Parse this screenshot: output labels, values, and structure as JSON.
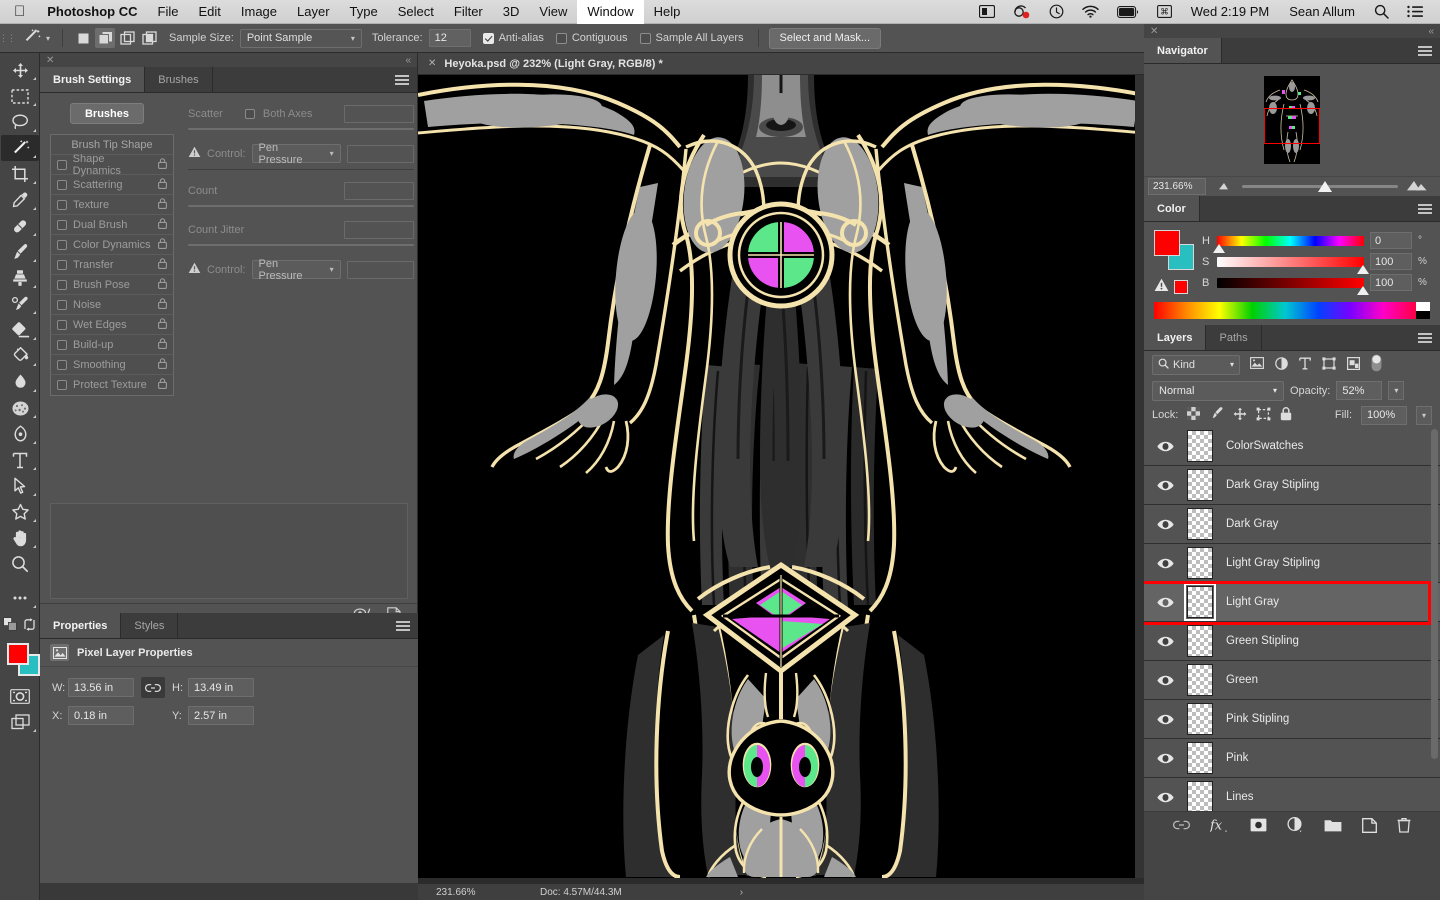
{
  "menubar": {
    "apple_icon": "apple-logo-icon",
    "app_name": "Photoshop CC",
    "items": [
      "File",
      "Edit",
      "Image",
      "Layer",
      "Type",
      "Select",
      "Filter",
      "3D",
      "View",
      "Window",
      "Help"
    ],
    "active_item": "Window",
    "status_icons": [
      "screen-mirroring-icon",
      "record-icon",
      "time-machine-icon",
      "wifi-icon",
      "battery-icon",
      "input-source-icon"
    ],
    "clock": "Wed 2:19 PM",
    "user": "Sean Allum",
    "search_icon": "search-icon",
    "control_center_icon": "control-center-icon"
  },
  "options_bar": {
    "tool_icon": "magic-wand-icon",
    "tool_caret": "chevron-down-icon",
    "selection_modes": [
      "new-selection-icon",
      "add-to-selection-icon",
      "subtract-from-selection-icon",
      "intersect-selection-icon"
    ],
    "active_selection_mode_index": 1,
    "sample_size_label": "Sample Size:",
    "sample_size_value": "Point Sample",
    "tolerance_label": "Tolerance:",
    "tolerance_value": "12",
    "anti_alias_label": "Anti-alias",
    "anti_alias_checked": true,
    "contiguous_label": "Contiguous",
    "contiguous_checked": false,
    "sample_all_layers_label": "Sample All Layers",
    "sample_all_layers_checked": false,
    "select_and_mask_label": "Select and Mask...",
    "right_icons": [
      "search-icon",
      "workspace-icon",
      "chevron-down-icon",
      "share-icon"
    ]
  },
  "toolbar": {
    "tools": [
      {
        "name": "move-tool",
        "icon": "move-icon"
      },
      {
        "name": "rectangular-marquee-tool",
        "icon": "marquee-icon"
      },
      {
        "name": "lasso-tool",
        "icon": "lasso-icon"
      },
      {
        "name": "magic-wand-tool",
        "icon": "magic-wand-icon",
        "selected": true
      },
      {
        "name": "crop-tool",
        "icon": "crop-icon"
      },
      {
        "name": "eyedropper-tool",
        "icon": "eyedropper-icon"
      },
      {
        "name": "spot-healing-brush-tool",
        "icon": "healing-brush-icon"
      },
      {
        "name": "brush-tool",
        "icon": "brush-icon"
      },
      {
        "name": "clone-stamp-tool",
        "icon": "stamp-icon"
      },
      {
        "name": "history-brush-tool",
        "icon": "history-brush-icon"
      },
      {
        "name": "eraser-tool",
        "icon": "eraser-icon"
      },
      {
        "name": "gradient-tool",
        "icon": "paint-bucket-icon"
      },
      {
        "name": "blur-tool",
        "icon": "blur-drop-icon"
      },
      {
        "name": "dodge-tool",
        "icon": "sponge-icon"
      },
      {
        "name": "pen-tool",
        "icon": "pen-icon"
      },
      {
        "name": "type-tool",
        "icon": "type-t-icon"
      },
      {
        "name": "path-selection-tool",
        "icon": "arrow-pointer-icon"
      },
      {
        "name": "custom-shape-tool",
        "icon": "shape-star-icon"
      },
      {
        "name": "hand-tool",
        "icon": "hand-icon"
      },
      {
        "name": "zoom-tool",
        "icon": "magnifier-icon"
      },
      {
        "name": "edit-toolbar",
        "icon": "ellipsis-icon"
      }
    ],
    "quick_icons": [
      "default-colors-icon",
      "swap-colors-icon"
    ],
    "foreground_color": "#fe0000",
    "background_color": "#29bfc0",
    "quick_mask_icon": "quick-mask-icon",
    "screen_mode_icon": "screen-mode-icon"
  },
  "brush_settings": {
    "tabs": [
      {
        "label": "Brush Settings",
        "active": true
      },
      {
        "label": "Brushes",
        "active": false
      }
    ],
    "menu_icon": "panel-menu-icon",
    "close_icon": "close-icon",
    "collapse_icon": "collapse-icon",
    "brushes_button": "Brushes",
    "list_header": "Brush Tip Shape",
    "options": [
      "Shape Dynamics",
      "Scattering",
      "Texture",
      "Dual Brush",
      "Color Dynamics",
      "Transfer",
      "Brush Pose",
      "Noise",
      "Wet Edges",
      "Build-up",
      "Smoothing",
      "Protect Texture"
    ],
    "scatter_label": "Scatter",
    "both_axes_label": "Both Axes",
    "both_axes_checked": false,
    "control_label": "Control:",
    "control_value": "Pen Pressure",
    "count_label": "Count",
    "count_jitter_label": "Count Jitter",
    "control2_label": "Control:",
    "control2_value": "Pen Pressure",
    "footer_icons": [
      "toggle-brush-preview-icon",
      "new-brush-icon"
    ]
  },
  "properties": {
    "tabs": [
      {
        "label": "Properties",
        "active": true
      },
      {
        "label": "Styles",
        "active": false
      }
    ],
    "menu_icon": "panel-menu-icon",
    "header_icon": "pixel-layer-icon",
    "header_title": "Pixel Layer Properties",
    "fields": [
      {
        "label": "W:",
        "value": "13.56 in",
        "name": "width-field"
      },
      {
        "label": "H:",
        "value": "13.49 in",
        "name": "height-field"
      },
      {
        "label": "X:",
        "value": "0.18 in",
        "name": "x-field"
      },
      {
        "label": "Y:",
        "value": "2.57 in",
        "name": "y-field"
      }
    ],
    "link_icon": "link-dimensions-icon"
  },
  "document": {
    "close_icon": "close-icon",
    "tab_title": "Heyoka.psd @ 232% (Light Gray, RGB/8) *"
  },
  "status_bar": {
    "zoom": "231.66%",
    "zoom_unit": "%",
    "doc_info": "Doc: 4.57M/44.3M",
    "arrow_icon": "chevron-right-icon"
  },
  "navigator": {
    "tabs": [
      {
        "label": "Navigator",
        "active": true
      }
    ],
    "menu_icon": "panel-menu-icon",
    "zoom_value": "231.66%",
    "zoom_out_icon": "zoom-out-mountain-icon",
    "zoom_in_icon": "zoom-in-mountain-icon",
    "view_box_color": "#ff0000"
  },
  "color": {
    "tabs": [
      {
        "label": "Color",
        "active": true
      }
    ],
    "menu_icon": "panel-menu-icon",
    "foreground": "#fe0000",
    "background": "#29bfc0",
    "warning_icon": "out-of-gamut-warning-icon",
    "warning_swatch": "#fe0000",
    "sliders": [
      {
        "label": "H",
        "value": "0",
        "unit": "°",
        "knob_pct": 0
      },
      {
        "label": "S",
        "value": "100",
        "unit": "%",
        "knob_pct": 100
      },
      {
        "label": "B",
        "value": "100",
        "unit": "%",
        "knob_pct": 100
      }
    ]
  },
  "layers": {
    "tabs": [
      {
        "label": "Layers",
        "active": true
      },
      {
        "label": "Paths",
        "active": false
      }
    ],
    "menu_icon": "panel-menu-icon",
    "filter_label": "Kind",
    "filter_icon": "search-icon",
    "filter_type_icons": [
      "pixel-filter-icon",
      "adjustment-filter-icon",
      "type-filter-icon",
      "shape-filter-icon",
      "smart-object-filter-icon"
    ],
    "filter_toggle_icon": "filter-toggle-icon",
    "blend_mode": "Normal",
    "opacity_label": "Opacity:",
    "opacity_value": "52%",
    "lock_label": "Lock:",
    "lock_icons": [
      "lock-transparency-icon",
      "lock-image-icon",
      "lock-position-icon",
      "lock-artboard-icon",
      "lock-all-icon"
    ],
    "fill_label": "Fill:",
    "fill_value": "100%",
    "selected_layer": "Light Gray",
    "items": [
      {
        "name": "ColorSwatches",
        "visible": true
      },
      {
        "name": "Dark Gray Stipling",
        "visible": true
      },
      {
        "name": "Dark Gray",
        "visible": true
      },
      {
        "name": "Light Gray Stipling",
        "visible": true
      },
      {
        "name": "Light Gray",
        "visible": true,
        "selected": true
      },
      {
        "name": "Green Stipling",
        "visible": true
      },
      {
        "name": "Green",
        "visible": true
      },
      {
        "name": "Pink Stipling",
        "visible": true
      },
      {
        "name": "Pink",
        "visible": true
      },
      {
        "name": "Lines",
        "visible": true
      }
    ],
    "footer_icons": [
      "link-layers-icon",
      "layer-styles-fx-icon",
      "add-layer-mask-icon",
      "new-adjustment-layer-icon",
      "new-group-icon",
      "new-layer-icon",
      "delete-layer-icon"
    ],
    "selection_highlight_color": "#ff0000"
  },
  "artwork": {
    "description": "Heyoka.psd — symmetric figure illustration",
    "background": "#000000",
    "line_color": "#f5e3ae",
    "gray_light": "#a0a0a0",
    "gray_dark": "#3a3a3a",
    "accent_green": "#5ce88a",
    "accent_magenta": "#e852f0"
  }
}
